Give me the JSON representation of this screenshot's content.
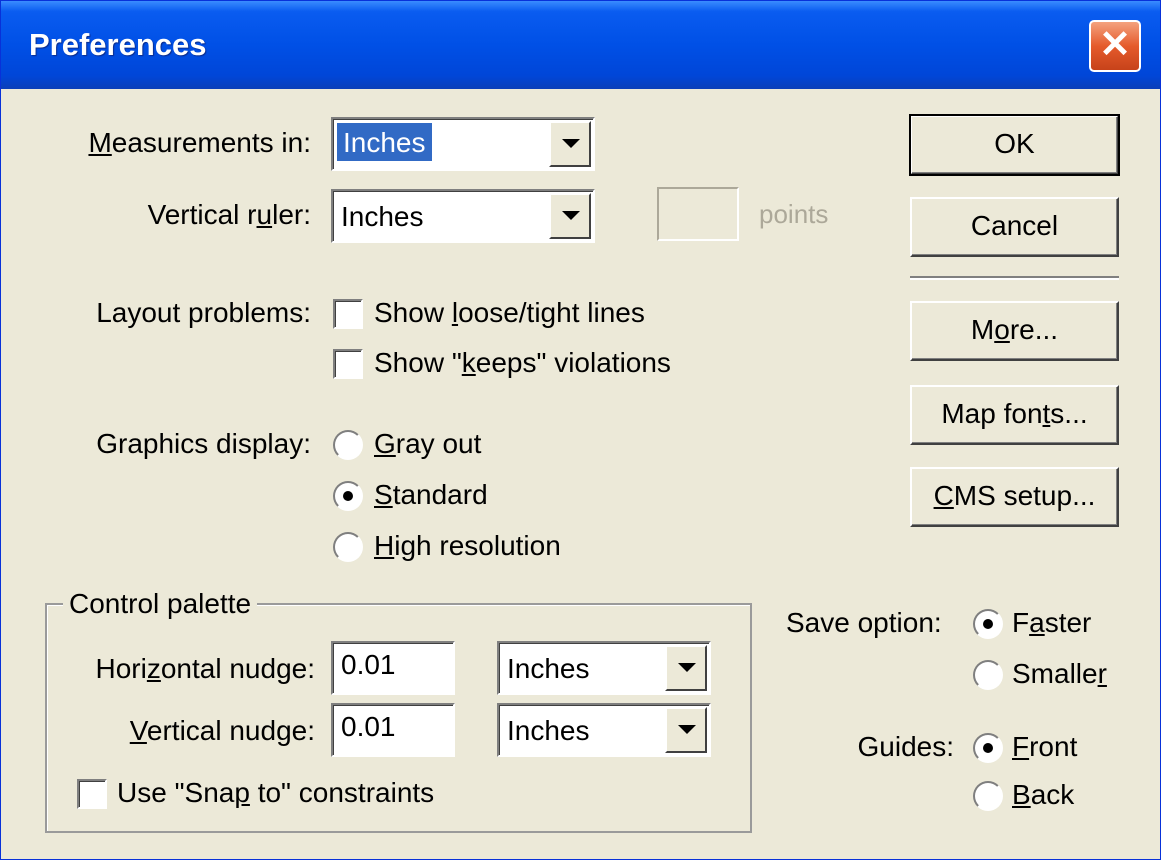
{
  "window": {
    "title": "Preferences",
    "close_glyph": "✕"
  },
  "measurements": {
    "label_prefix": "",
    "label_u": "M",
    "label_rest": "easurements in:",
    "value": "Inches"
  },
  "vertical_ruler": {
    "label_prefix": "Vertical r",
    "label_u": "u",
    "label_rest": "ler:",
    "value": "Inches",
    "points_label": "points"
  },
  "layout_problems": {
    "label": "Layout problems:",
    "loose_prefix": "Show ",
    "loose_u": "l",
    "loose_rest": "oose/tight lines",
    "keeps_prefix": "Show \"",
    "keeps_u": "k",
    "keeps_rest": "eeps\" violations"
  },
  "graphics_display": {
    "label": "Graphics display:",
    "opt1_u": "G",
    "opt1_rest": "ray out",
    "opt2_u": "S",
    "opt2_rest": "tandard",
    "opt3_u": "H",
    "opt3_rest": "igh resolution",
    "selected": "Standard"
  },
  "control_palette": {
    "title": "Control palette",
    "hnudge_prefix": "Hori",
    "hnudge_u": "z",
    "hnudge_rest": "ontal nudge:",
    "hnudge_value": "0.01",
    "hnudge_unit": "Inches",
    "vnudge_prefix": "",
    "vnudge_u": "V",
    "vnudge_rest": "ertical nudge:",
    "vnudge_value": "0.01",
    "vnudge_unit": "Inches",
    "snap_prefix": "Use \"Sna",
    "snap_u": "p",
    "snap_rest": " to\" constraints"
  },
  "buttons": {
    "ok_prefix": "",
    "ok_u": "",
    "ok_rest": "OK",
    "cancel": "Cancel",
    "more_prefix": "M",
    "more_u": "o",
    "more_rest": "re...",
    "map_prefix": "Map fon",
    "map_u": "t",
    "map_rest": "s...",
    "cms_prefix": "",
    "cms_u": "C",
    "cms_rest": "MS setup..."
  },
  "save_option": {
    "label": "Save option:",
    "faster_prefix": "F",
    "faster_u": "a",
    "faster_rest": "ster",
    "smaller_prefix": "Smalle",
    "smaller_u": "r",
    "smaller_rest": "",
    "selected": "Faster"
  },
  "guides": {
    "label": "Guides:",
    "front_prefix": "",
    "front_u": "F",
    "front_rest": "ront",
    "back_prefix": "",
    "back_u": "B",
    "back_rest": "ack",
    "selected": "Front"
  }
}
